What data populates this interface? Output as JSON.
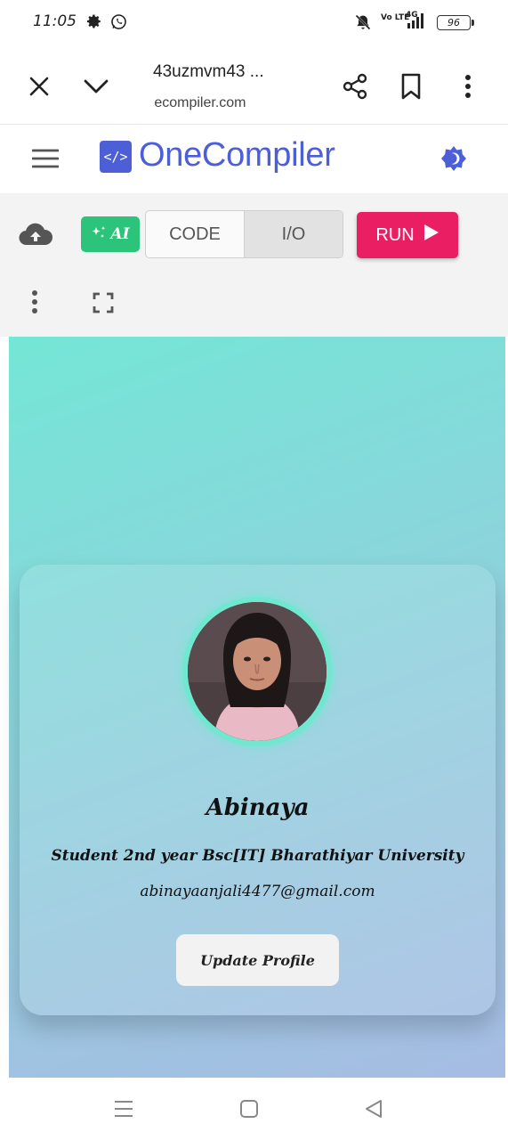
{
  "status_bar": {
    "time": "11:05",
    "network_label": "Vo LTE",
    "network_type": "4G",
    "battery": "96",
    "icons": [
      "settings-icon",
      "whatsapp-icon",
      "mute-bell-icon",
      "signal-icon"
    ]
  },
  "browser": {
    "title": "43uzmvm43 ...",
    "url": " ecompiler.com",
    "icons": [
      "close-icon",
      "chevron-down-icon",
      "share-icon",
      "bookmark-icon",
      "more-vertical-icon"
    ]
  },
  "site_header": {
    "logo_glyph": "</>",
    "logo_text": "OneCompiler",
    "brand_color": "#4c5fd7",
    "icons": [
      "menu-icon",
      "theme-toggle-icon"
    ]
  },
  "toolbar": {
    "ai_label": "AI",
    "code_tab": "CODE",
    "io_tab": "I/O",
    "active_tab": "I/O",
    "run_label": "RUN",
    "run_color": "#e91e63",
    "ai_color": "#2bc47a",
    "icons": [
      "cloud-upload-icon",
      "sparkle-icon",
      "play-icon",
      "more-vertical-icon",
      "fullscreen-icon"
    ]
  },
  "profile": {
    "name": "Abinaya",
    "role": "Student 2nd year Bsc[IT] Bharathiyar University",
    "email": "abinayaanjali4477@gmail.com",
    "button_label": "Update Profile"
  },
  "nav_bar": {
    "icons": [
      "recents-icon",
      "home-icon",
      "back-icon"
    ]
  }
}
